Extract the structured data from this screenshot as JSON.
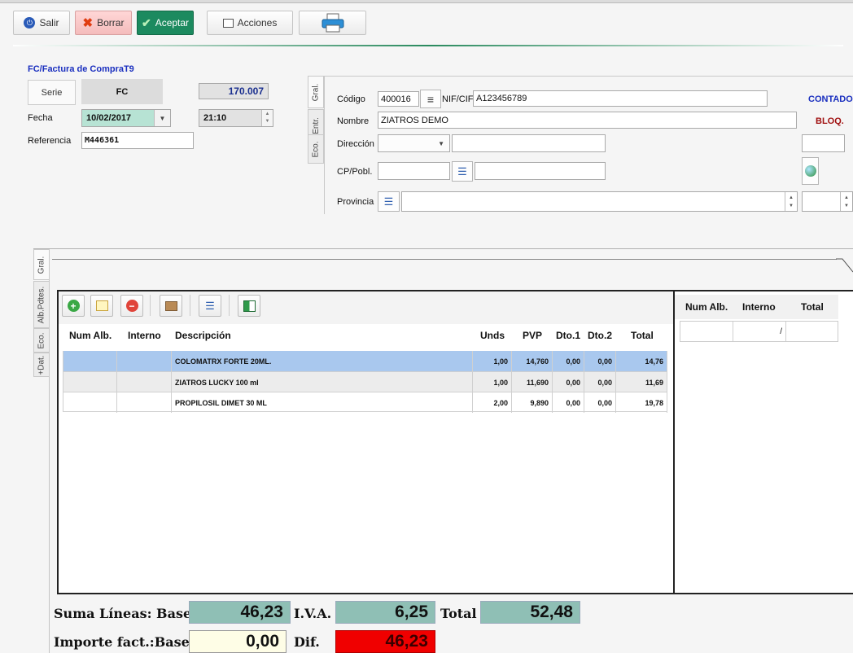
{
  "toolbar": {
    "salir": "Salir",
    "borrar": "Borrar",
    "aceptar": "Aceptar",
    "acciones": "Acciones"
  },
  "header": {
    "title": "FC/Factura de CompraT9",
    "serie_label": "Serie",
    "serie_value": "FC",
    "number": "170.007",
    "fecha_label": "Fecha",
    "fecha_value": "10/02/2017",
    "hora_value": "21:10",
    "referencia_label": "Referencia",
    "referencia_value": "M446361"
  },
  "proveedor": {
    "tabs": [
      "Gral.",
      "Entr.",
      "Eco."
    ],
    "codigo_label": "Código",
    "codigo_value": "400016",
    "nif_label": "NIF/CIF",
    "nif_value": "A123456789",
    "nombre_label": "Nombre",
    "nombre_value": "ZIATROS DEMO",
    "direccion_label": "Dirección",
    "cp_label": "CP/Pobl.",
    "provincia_label": "Provincia",
    "contado": "CONTADO",
    "bloq": "BLOQ."
  },
  "lines_tabs": [
    "Gral.",
    "Alb.Pdtes.",
    "Eco.",
    "+Dat."
  ],
  "lines": {
    "columns": [
      "Num Alb.",
      "Interno",
      "Descripción",
      "Unds",
      "PVP",
      "Dto.1",
      "Dto.2",
      "Total"
    ],
    "rows": [
      {
        "num_alb": "",
        "interno": "",
        "descripcion": "COLOMATRX FORTE 20ML.",
        "unds": "1,00",
        "pvp": "14,760",
        "dto1": "0,00",
        "dto2": "0,00",
        "total": "14,76"
      },
      {
        "num_alb": "",
        "interno": "",
        "descripcion": "ZIATROS LUCKY 100 ml",
        "unds": "1,00",
        "pvp": "11,690",
        "dto1": "0,00",
        "dto2": "0,00",
        "total": "11,69"
      },
      {
        "num_alb": "",
        "interno": "",
        "descripcion": "PROPILOSIL DIMET 30 ML",
        "unds": "2,00",
        "pvp": "9,890",
        "dto1": "0,00",
        "dto2": "0,00",
        "total": "19,78"
      }
    ]
  },
  "albaranes": {
    "columns": [
      "Num Alb.",
      "Interno",
      "Total"
    ],
    "row": {
      "num_alb": "",
      "interno": "/",
      "total": ""
    }
  },
  "totals": {
    "suma_label": "Suma Líneas: Bases",
    "suma_bases": "46,23",
    "iva_label": "I.V.A.",
    "iva_value": "6,25",
    "total_label": "Total",
    "total_value": "52,48",
    "importe_label": "Importe fact.:Bases",
    "importe_value": "0,00",
    "dif_label": "Dif.",
    "dif_value": "46,23"
  },
  "colors": {
    "accent_green": "#1c8a5f",
    "total_box": "#8fbfb5",
    "diff_red": "#f00000",
    "selected_row": "#a9c8ee",
    "title_blue": "#1a2fbf",
    "bloq_red": "#a01010"
  }
}
